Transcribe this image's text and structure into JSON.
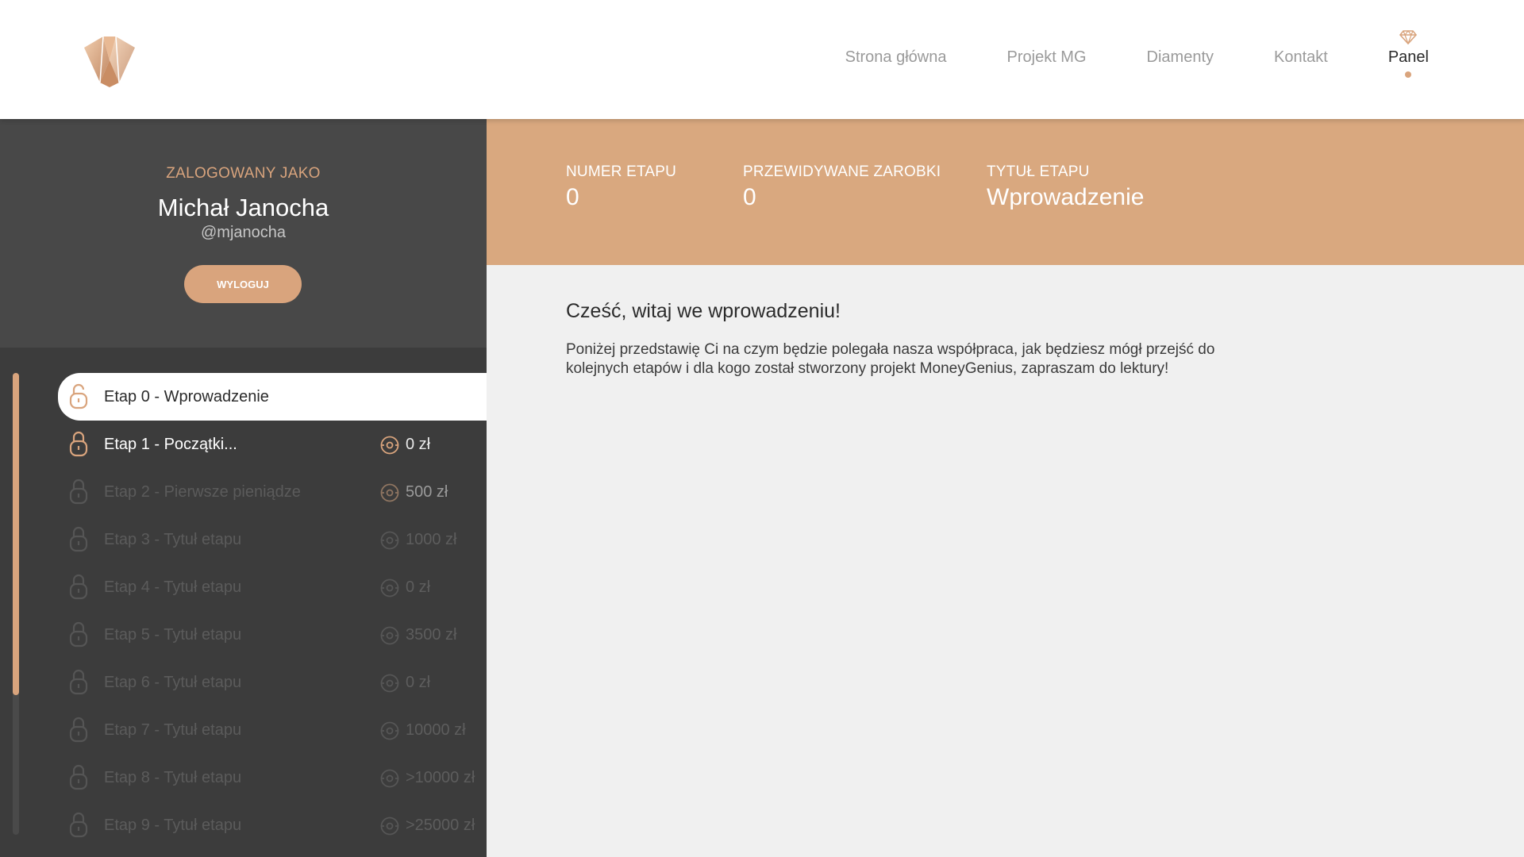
{
  "colors": {
    "accent": "#d9a47d",
    "sidebar_bg": "#3c3c3c",
    "profile_bg": "#484848",
    "banner_bg": "#d9a87f",
    "content_bg": "#f0f0f0"
  },
  "header": {
    "logo_icon": "diamond-logo-icon",
    "nav": [
      {
        "label": "Strona główna"
      },
      {
        "label": "Projekt MG"
      },
      {
        "label": "Diamenty"
      },
      {
        "label": "Kontakt"
      },
      {
        "label": "Panel",
        "active": true,
        "icon": "diamond-icon"
      }
    ]
  },
  "profile": {
    "logged_label": "ZALOGOWANY JAKO",
    "name": "Michał Janocha",
    "handle": "@mjanocha",
    "logout_label": "WYLOGUJ"
  },
  "stages": [
    {
      "title": "Etap 0 - Wprowadzenie",
      "amount": "",
      "state": "active",
      "icon": "lock-open-icon"
    },
    {
      "title": "Etap 1 - Początki...",
      "amount": "0 zł",
      "state": "unlocked",
      "icon": "lock-icon"
    },
    {
      "title": "Etap 2 - Pierwsze pieniądze",
      "amount": "500 zł",
      "state": "locked",
      "icon": "lock-icon"
    },
    {
      "title": "Etap 3 - Tytuł etapu",
      "amount": "1000 zł",
      "state": "locked",
      "icon": "lock-icon"
    },
    {
      "title": "Etap 4 - Tytuł etapu",
      "amount": "0 zł",
      "state": "locked",
      "icon": "lock-icon"
    },
    {
      "title": "Etap 5 - Tytuł etapu",
      "amount": "3500 zł",
      "state": "locked",
      "icon": "lock-icon"
    },
    {
      "title": "Etap 6 - Tytuł etapu",
      "amount": "0 zł",
      "state": "locked",
      "icon": "lock-icon"
    },
    {
      "title": "Etap 7 - Tytuł etapu",
      "amount": "10000 zł",
      "state": "locked",
      "icon": "lock-icon"
    },
    {
      "title": "Etap 8 - Tytuł etapu",
      "amount": ">10000 zł",
      "state": "locked",
      "icon": "lock-icon"
    },
    {
      "title": "Etap 9 - Tytuł etapu",
      "amount": ">25000 zł",
      "state": "locked",
      "icon": "lock-icon"
    }
  ],
  "stage_info": {
    "number_label": "NUMER ETAPU",
    "number_value": "0",
    "earnings_label": "PRZEWIDYWANE ZAROBKI",
    "earnings_value": "0",
    "title_label": "TYTUŁ ETAPU",
    "title_value": "Wprowadzenie"
  },
  "content": {
    "heading": "Cześć, witaj we wprowadzeniu!",
    "body": "Poniżej przedstawię Ci na czym będzie polegała nasza współpraca, jak będziesz mógł przejść do kolejnych etapów i dla kogo został stworzony projekt MoneyGenius, zapraszam do lektury!"
  }
}
